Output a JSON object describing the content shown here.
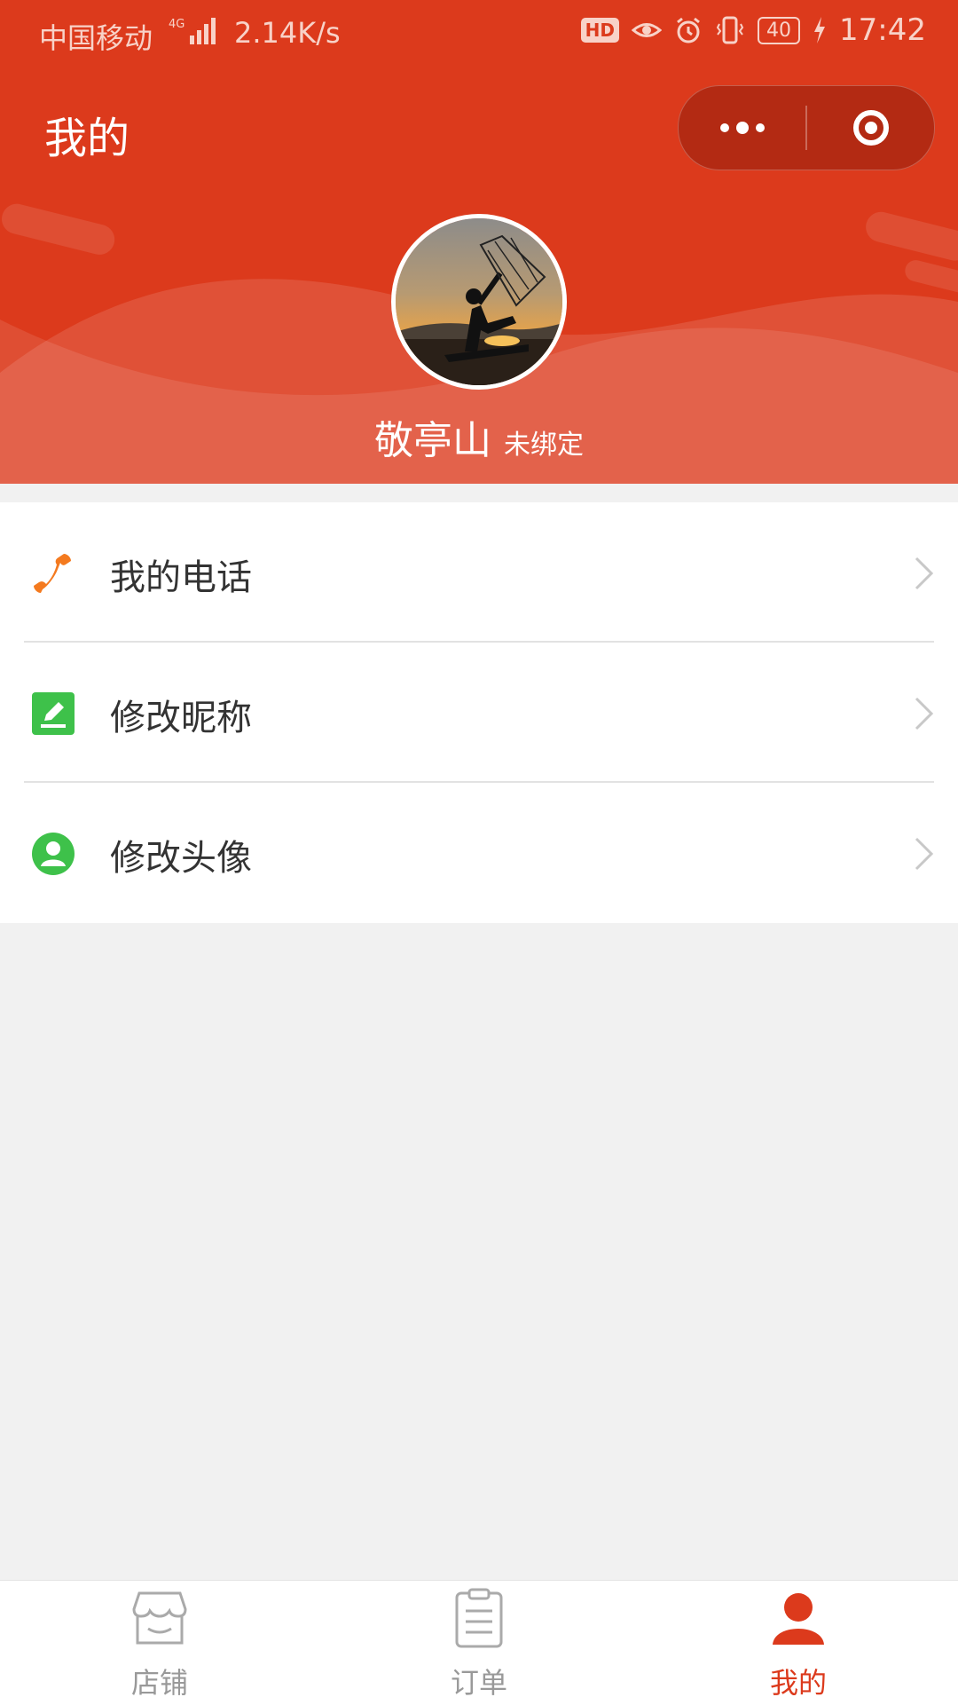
{
  "status_bar": {
    "carrier": "中国移动",
    "network": "4G",
    "speed": "2.14K/s",
    "hd": "HD",
    "battery": "40",
    "time": "17:42"
  },
  "header": {
    "title": "我的",
    "bg_color": "#dc3a1c"
  },
  "profile": {
    "name": "敬亭山",
    "bind_status": "未绑定"
  },
  "menu": {
    "items": [
      {
        "label": "我的电话",
        "icon": "phone-icon",
        "icon_color": "#f47a1f"
      },
      {
        "label": "修改昵称",
        "icon": "edit-icon",
        "icon_color": "#3ec14a"
      },
      {
        "label": "修改头像",
        "icon": "user-icon",
        "icon_color": "#3ec14a"
      }
    ]
  },
  "tabbar": {
    "tabs": [
      {
        "label": "店铺",
        "icon": "store-icon",
        "active": false
      },
      {
        "label": "订单",
        "icon": "clipboard-icon",
        "active": false
      },
      {
        "label": "我的",
        "icon": "profile-icon",
        "active": true
      }
    ],
    "active_color": "#dc3a1c",
    "inactive_color": "#999999"
  }
}
